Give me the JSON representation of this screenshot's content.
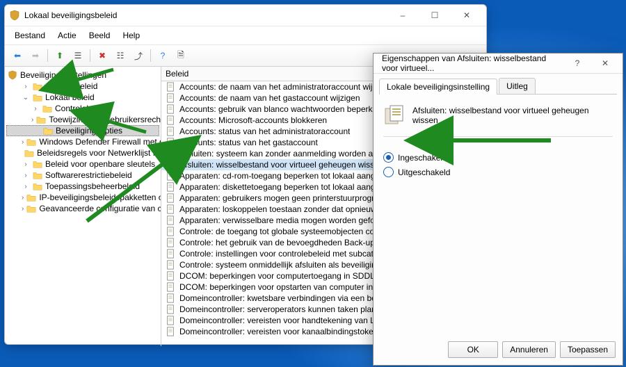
{
  "window": {
    "title": "Lokaal beveiligingsbeleid",
    "menu": [
      "Bestand",
      "Actie",
      "Beeld",
      "Help"
    ],
    "toolbar_icons": [
      "back-icon",
      "forward-icon",
      "up-icon",
      "show-hide-icon",
      "delete-icon",
      "properties-icon",
      "export-icon",
      "help-icon",
      "refresh-icon"
    ]
  },
  "tree": {
    "root": "Beveiligingsinstellingen",
    "items": [
      {
        "exp": ">",
        "label": "Accountbeleid"
      },
      {
        "exp": "v",
        "label": "Lokaal beleid",
        "children": [
          {
            "exp": ">",
            "label": "Controlebeleid"
          },
          {
            "exp": ">",
            "label": "Toewijzing van gebruikersrechten"
          },
          {
            "exp": "",
            "label": "Beveiligingsopties",
            "sel": true
          }
        ]
      },
      {
        "exp": ">",
        "label": "Windows Defender Firewall met geava"
      },
      {
        "exp": "",
        "label": "Beleidsregels voor Netwerklijst Manag"
      },
      {
        "exp": ">",
        "label": "Beleid voor openbare sleutels"
      },
      {
        "exp": ">",
        "label": "Softwarerestrictiebeleid"
      },
      {
        "exp": ">",
        "label": "Toepassingsbeheerbeleid"
      },
      {
        "exp": ">",
        "label": "IP-beveiligingsbeleidspakketten op Lo"
      },
      {
        "exp": ">",
        "label": "Geavanceerde configuratie van controle"
      }
    ]
  },
  "list": {
    "header": "Beleid",
    "rows": [
      "Accounts: de naam van het administratoraccount wijzigen",
      "Accounts: de naam van het gastaccount wijzigen",
      "Accounts: gebruik van blanco wachtwoorden beperken tot aa...",
      "Accounts: Microsoft-accounts blokkeren",
      "Accounts: status van het administratoraccount",
      "Accounts: status van het gastaccount",
      "Afsluiten: systeem kan zonder aanmelding worden afgesloten",
      "Afsluiten: wisselbestand voor virtueel geheugen wissen",
      "Apparaten: cd-rom-toegang beperken tot lokaal aangemelde...",
      "Apparaten: diskettetoegang beperken tot lokaal aangemelde ...",
      "Apparaten: gebruikers mogen geen printerstuurprogramma's...",
      "Apparaten: loskoppelen toestaan zonder dat opnieuw hoeft t...",
      "Apparaten: verwisselbare media mogen worden geformatteer...",
      "Controle: de toegang tot globale systeemobjecten controleren",
      "Controle: het gebruik van de bevoegdheden Back-up en Teru...",
      "Controle: instellingen voor controlebeleid met subcategorieë...",
      "Controle: systeem onmiddellijk afsluiten als beveiligingscontr...",
      "DCOM: beperkingen voor computertoegang in SDDL (Securit...",
      "DCOM: beperkingen voor opstarten van computer in SDDL (S...",
      "Domeincontroller: kwetsbare verbindingen via een beveiligd ...",
      "Domeincontroller: serveroperators kunnen taken plannen",
      "Domeincontroller: vereisten voor handtekening van LDAP-ser...",
      "Domeincontroller: vereisten voor kanaalbindingstoken van L..."
    ],
    "selected_index": 7
  },
  "dialog": {
    "title": "Eigenschappen van Afsluiten: wisselbestand voor virtueel...",
    "tabs": [
      "Lokale beveiligingsinstelling",
      "Uitleg"
    ],
    "policy_label": "Afsluiten: wisselbestand voor virtueel geheugen wissen",
    "radio_enabled": "Ingeschakeld",
    "radio_disabled": "Uitgeschakeld",
    "selected": "enabled",
    "buttons": {
      "ok": "OK",
      "cancel": "Annuleren",
      "apply": "Toepassen"
    }
  }
}
